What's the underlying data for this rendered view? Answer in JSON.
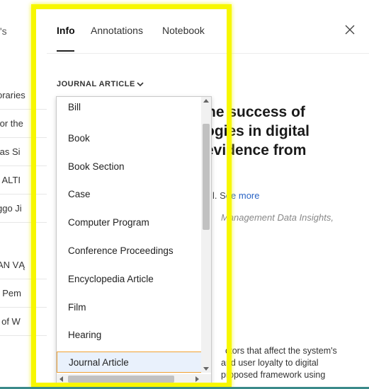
{
  "left_panel": {
    "crumb": "'s",
    "rows": [
      "oraries",
      "for the",
      "tas Si",
      "ı ALTI",
      "ggo Ji",
      "AN VĄ",
      "ı Pem",
      "' of W"
    ]
  },
  "tabs": [
    {
      "label": "Info",
      "active": true
    },
    {
      "label": "Annotations",
      "active": false
    },
    {
      "label": "Notebook",
      "active": false
    }
  ],
  "type_selector": {
    "label": "JOURNAL ARTICLE"
  },
  "article": {
    "title_lines": [
      "the success of",
      "ogies in digital",
      "evidence from"
    ],
    "authors_fragment": "l. S",
    "see_more": "ee more",
    "source": "Management Data Insights,",
    "abstract_lines": [
      "ctors that affect the system's",
      "and user loyalty to digital",
      "proposed framework using"
    ]
  },
  "dropdown": {
    "items": [
      "Bill",
      "Book",
      "Book Section",
      "Case",
      "Computer Program",
      "Conference Proceedings",
      "Encyclopedia Article",
      "Film",
      "Hearing",
      "Journal Article"
    ],
    "selected": "Journal Article"
  },
  "colors": {
    "highlight": "#f7f700",
    "link": "#2a64c5",
    "selected_border": "#f0a030",
    "selected_bg": "#e9f1fc"
  }
}
